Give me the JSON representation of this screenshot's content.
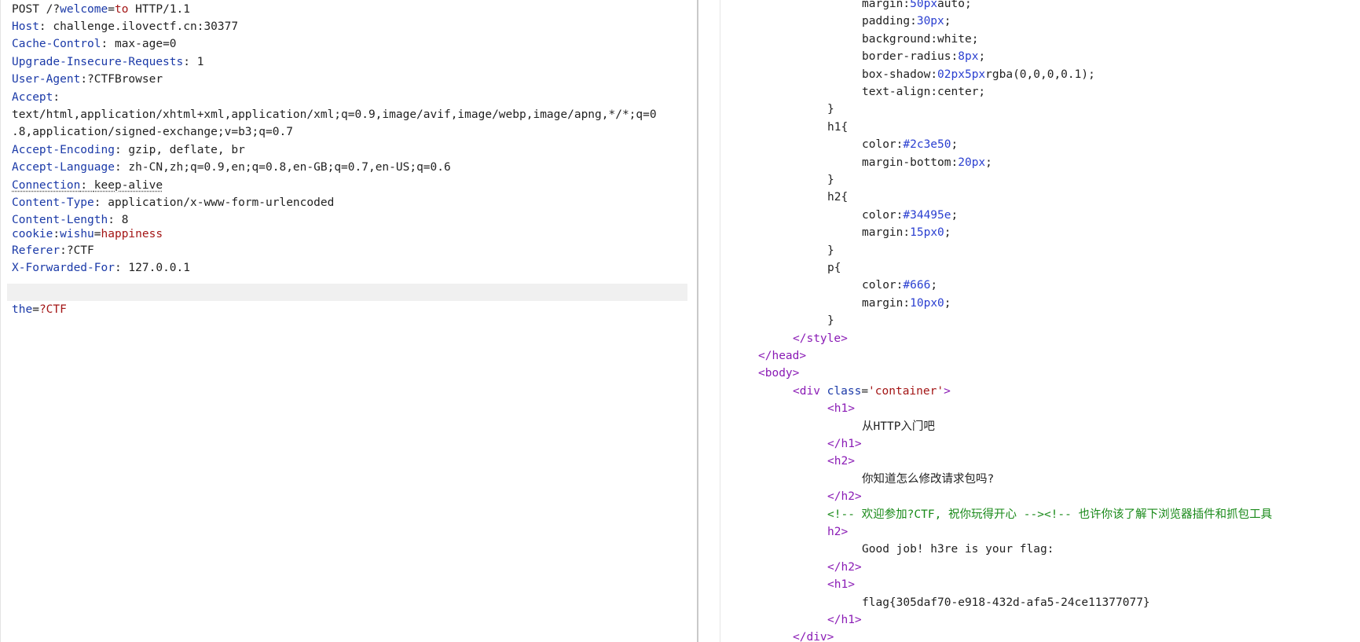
{
  "request": {
    "method": "POST",
    "path": "/?",
    "query_param_name": "welcome",
    "query_eq": "=",
    "query_param_value": "to",
    "protocol": "HTTP/1.1",
    "headers": [
      {
        "key": "Host",
        "sep": ": ",
        "value": "challenge.ilovectf.cn:30377"
      },
      {
        "key": "Cache-Control",
        "sep": ": ",
        "value": "max-age=0"
      },
      {
        "key": "Upgrade-Insecure-Requests",
        "sep": ": ",
        "value": "1"
      },
      {
        "key": "User-Agent",
        "sep": ":",
        "value": "?CTFBrowser"
      },
      {
        "key": "Accept",
        "sep": ":",
        "value": ""
      },
      {
        "key": "",
        "sep": "",
        "value": "text/html,application/xhtml+xml,application/xml;q=0.9,image/avif,image/webp,image/apng,*/*;q=0"
      },
      {
        "key": "",
        "sep": "",
        "value": ".8,application/signed-exchange;v=b3;q=0.7"
      },
      {
        "key": "Accept-Encoding",
        "sep": ": ",
        "value": "gzip, deflate, br"
      },
      {
        "key": "Accept-Language",
        "sep": ": ",
        "value": "zh-CN,zh;q=0.9,en;q=0.8,en-GB;q=0.7,en-US;q=0.6"
      },
      {
        "key": "Connection",
        "sep": ": ",
        "value": "keep-alive"
      },
      {
        "key": "Content-Type",
        "sep": ": ",
        "value": "application/x-www-form-urlencoded"
      },
      {
        "key": "Content-Length",
        "sep": ": ",
        "value": "8"
      }
    ],
    "cookie": {
      "key": "cookie",
      "sep": ":",
      "name": "wishu",
      "eq": "=",
      "value": "happiness"
    },
    "referer": {
      "key": "Referer",
      "sep": ":",
      "value": "?CTF"
    },
    "xff": {
      "key": "X-Forwarded-For",
      "sep": ": ",
      "value": "127.0.0.1"
    },
    "body": {
      "name": "the",
      "eq": "=",
      "value": "?CTF"
    }
  },
  "response": {
    "css_lines": [
      {
        "indent": 3,
        "prop": "margin",
        "colon": ":",
        "val": "50px",
        "rest": "auto;"
      },
      {
        "indent": 3,
        "prop": "padding",
        "colon": ":",
        "val": "30px",
        "rest": ";"
      },
      {
        "indent": 3,
        "prop": "background",
        "colon": ":",
        "val": "",
        "rest": "white;"
      },
      {
        "indent": 3,
        "prop": "border-radius",
        "colon": ":",
        "val": "8px",
        "rest": ";"
      },
      {
        "indent": 3,
        "prop": "box-shadow",
        "colon": ":",
        "val": "02px5px",
        "rest": "rgba(0,0,0,0.1);"
      },
      {
        "indent": 3,
        "prop": "text-align",
        "colon": ":",
        "val": "",
        "rest": "center;"
      },
      {
        "indent": 2,
        "prop": "",
        "colon": "",
        "val": "",
        "rest": "}"
      },
      {
        "indent": 2,
        "prop": "h1",
        "colon": "",
        "val": "",
        "rest": "{"
      },
      {
        "indent": 3,
        "prop": "color",
        "colon": ":",
        "val": "#2c3e50",
        "rest": ";"
      },
      {
        "indent": 3,
        "prop": "margin-bottom",
        "colon": ":",
        "val": "20px",
        "rest": ";"
      },
      {
        "indent": 2,
        "prop": "",
        "colon": "",
        "val": "",
        "rest": "}"
      },
      {
        "indent": 2,
        "prop": "h2",
        "colon": "",
        "val": "",
        "rest": "{"
      },
      {
        "indent": 3,
        "prop": "color",
        "colon": ":",
        "val": "#34495e",
        "rest": ";"
      },
      {
        "indent": 3,
        "prop": "margin",
        "colon": ":",
        "val": "15px0",
        "rest": ";"
      },
      {
        "indent": 2,
        "prop": "",
        "colon": "",
        "val": "",
        "rest": "}"
      },
      {
        "indent": 2,
        "prop": "p",
        "colon": "",
        "val": "",
        "rest": "{"
      },
      {
        "indent": 3,
        "prop": "color",
        "colon": ":",
        "val": "#666",
        "rest": ";"
      },
      {
        "indent": 3,
        "prop": "margin",
        "colon": ":",
        "val": "10px0",
        "rest": ";"
      },
      {
        "indent": 2,
        "prop": "",
        "colon": "",
        "val": "",
        "rest": "}"
      }
    ],
    "html_lines": [
      {
        "indent": 1,
        "kind": "tag",
        "text": "</style>"
      },
      {
        "indent": 0,
        "kind": "tag",
        "text": "</head>"
      },
      {
        "indent": 0,
        "kind": "tag",
        "text": "<body>"
      },
      {
        "indent": 1,
        "kind": "div",
        "open": "<div ",
        "attr": "class",
        "eq": "=",
        "str": "'container'",
        "close": ">"
      },
      {
        "indent": 2,
        "kind": "tag",
        "text": "<h1>"
      },
      {
        "indent": 3,
        "kind": "txt",
        "text": "从HTTP入门吧"
      },
      {
        "indent": 2,
        "kind": "tag",
        "text": "</h1>"
      },
      {
        "indent": 2,
        "kind": "tag",
        "text": "<h2>"
      },
      {
        "indent": 3,
        "kind": "txt",
        "text": "你知道怎么修改请求包吗?"
      },
      {
        "indent": 2,
        "kind": "tag",
        "text": "</h2>"
      },
      {
        "indent": 2,
        "kind": "cmt",
        "text": "<!-- 欢迎参加?CTF, 祝你玩得开心 --><!-- 也许你该了解下浏览器插件和抓包工具"
      },
      {
        "indent": 2,
        "kind": "tag",
        "text": "h2>"
      },
      {
        "indent": 3,
        "kind": "txt",
        "text": "Good job! h3re is your flag:"
      },
      {
        "indent": 2,
        "kind": "tag",
        "text": "</h2>"
      },
      {
        "indent": 2,
        "kind": "tag",
        "text": "<h1>"
      },
      {
        "indent": 3,
        "kind": "txt",
        "text": "flag{305daf70-e918-432d-afa5-24ce11377077}"
      },
      {
        "indent": 2,
        "kind": "tag",
        "text": "</h1>"
      },
      {
        "indent": 1,
        "kind": "tag",
        "text": "</div>"
      }
    ]
  },
  "colors": {
    "header_key": "#1b3aa8",
    "param_value": "#a31515",
    "html_tag": "#8a1bb5",
    "css_value": "#2a3fd0",
    "comment": "#1a8a1a"
  }
}
